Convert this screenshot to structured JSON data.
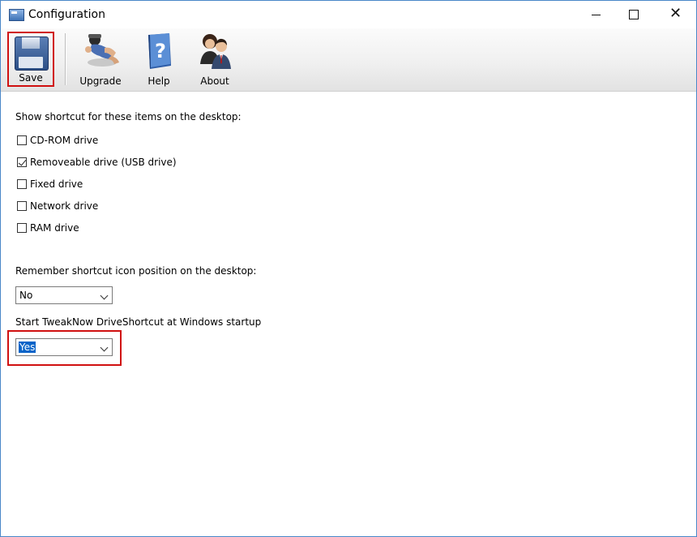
{
  "window": {
    "title": "Configuration",
    "minimize_icon": "minimize-icon",
    "maximize_icon": "maximize-icon",
    "close_icon": "close-icon"
  },
  "toolbar": {
    "save_label": "Save",
    "upgrade_label": "Upgrade",
    "help_label": "Help",
    "about_label": "About"
  },
  "settings": {
    "show_shortcut_heading": "Show shortcut for these items on the desktop:",
    "drives": [
      {
        "label": "CD-ROM drive",
        "checked": false
      },
      {
        "label": "Removeable drive (USB drive)",
        "checked": true
      },
      {
        "label": "Fixed drive",
        "checked": false
      },
      {
        "label": "Network drive",
        "checked": false
      },
      {
        "label": "RAM drive",
        "checked": false
      }
    ],
    "remember_heading": "Remember shortcut icon position on the desktop:",
    "remember_value": "No",
    "startup_heading": "Start TweakNow DriveShortcut at Windows startup",
    "startup_value": "Yes"
  },
  "colors": {
    "highlight": "#d01010",
    "selection": "#0a64c8",
    "window_border": "#4a87c8"
  }
}
